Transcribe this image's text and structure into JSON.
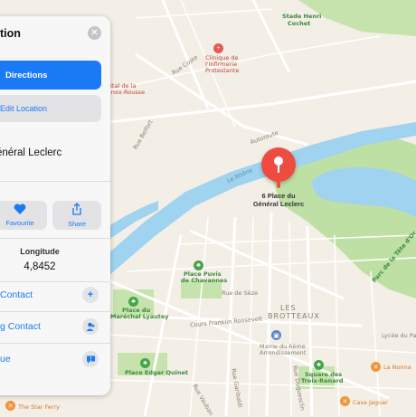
{
  "panel": {
    "title": "tion",
    "directions_label": "Directions",
    "edit_location_label": "Edit Location",
    "address": "énéral Leclerc",
    "actions": [
      {
        "label": "Favourite",
        "icon": "heart-icon"
      },
      {
        "label": "Share",
        "icon": "share-icon"
      }
    ],
    "longitude_label": "Longitude",
    "longitude_value": "4,8452",
    "rows": [
      {
        "label": "Contact",
        "icon": "plus-icon"
      },
      {
        "label": "g Contact",
        "icon": "add-person-icon"
      },
      {
        "label": "ue",
        "icon": "speech-bubble-icon"
      }
    ]
  },
  "map": {
    "pin_label_line1": "6 Place du",
    "pin_label_line2": "Général Leclerc",
    "labels": {
      "stade": "Stade Henri",
      "stade2": "Cochet",
      "clinique": "Clinique de",
      "clinique2": "l'Infirmerie",
      "clinique3": "Protestante",
      "hopital": "pital de la",
      "hopital2": "Croix-Rousse",
      "rue_coste": "Rue Coste",
      "rue_belfort": "Rue Belfort",
      "autoroute": "Autoroute",
      "le_rhone": "Le Rhône",
      "parc": "Parc de la Tête d'Or",
      "place_puvis": "Place Puvis",
      "place_puvis2": "de Chavannes",
      "place_lyautey": "Place du",
      "place_lyautey2": "Maréchal Lyautey",
      "les_brotteaux": "LES",
      "les_brotteaux2": "BROTTEAUX",
      "cours_franklin": "Cours Franklin Roosevelt",
      "mairie": "Mairie du 6ème",
      "mairie2": "Arrondissement",
      "place_edgar": "Place Edgar Quinet",
      "square": "Square des",
      "square2": "Trois-Renard",
      "lycee": "Lycée du Parc",
      "la_nonna": "La Nonna",
      "casa_jaguar": "Casa Jaguar",
      "star_ferry": "The Star Ferry",
      "rue_vauban": "Rue Vauban",
      "rue_duguesclin": "Rue Duguesclin",
      "rue_garibaldi": "Rue Garibaldi",
      "rue_de_seze": "Rue de Sèze"
    }
  },
  "colors": {
    "accent": "#1a7af5",
    "pin": "#ee4c40",
    "water": "#9fd3ef",
    "park": "#bfe0a5"
  }
}
